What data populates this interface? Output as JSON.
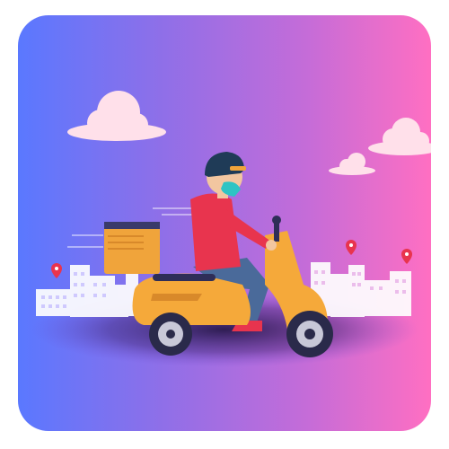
{
  "illustration": {
    "subject": "delivery-rider-on-scooter",
    "colors": {
      "gradient_left": "#5a78ff",
      "gradient_right": "#ff6fc2",
      "scooter": "#f5a93a",
      "delivery_box": "#f0a43b",
      "rider_shirt": "#e8344e",
      "rider_pants": "#4a6a9a",
      "helmet": "#1f3b57",
      "mask": "#2ec4c4",
      "clouds": "#ffe0ea",
      "buildings": "#ffffff",
      "map_pins": "#e8344e"
    }
  }
}
